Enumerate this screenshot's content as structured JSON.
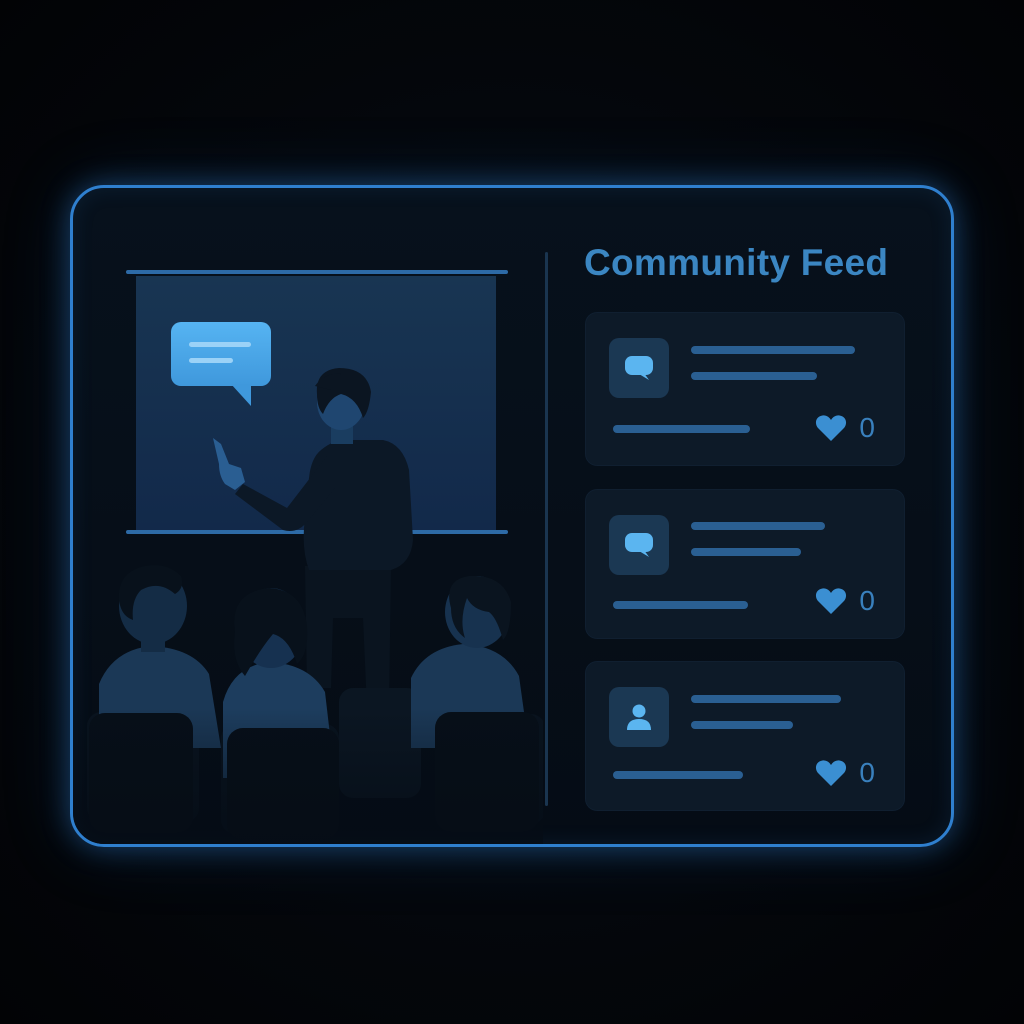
{
  "feed": {
    "title": "Community Feed",
    "posts": [
      {
        "icon": "chat-bubble-icon",
        "likes": "0"
      },
      {
        "icon": "chat-bubble-icon",
        "likes": "0"
      },
      {
        "icon": "user-icon",
        "likes": "0"
      }
    ]
  },
  "colors": {
    "accent": "#2f7fce",
    "title": "#3b86c2",
    "bubble": "#4aa8ec",
    "card": "#0d1a28",
    "background": "#030508"
  }
}
